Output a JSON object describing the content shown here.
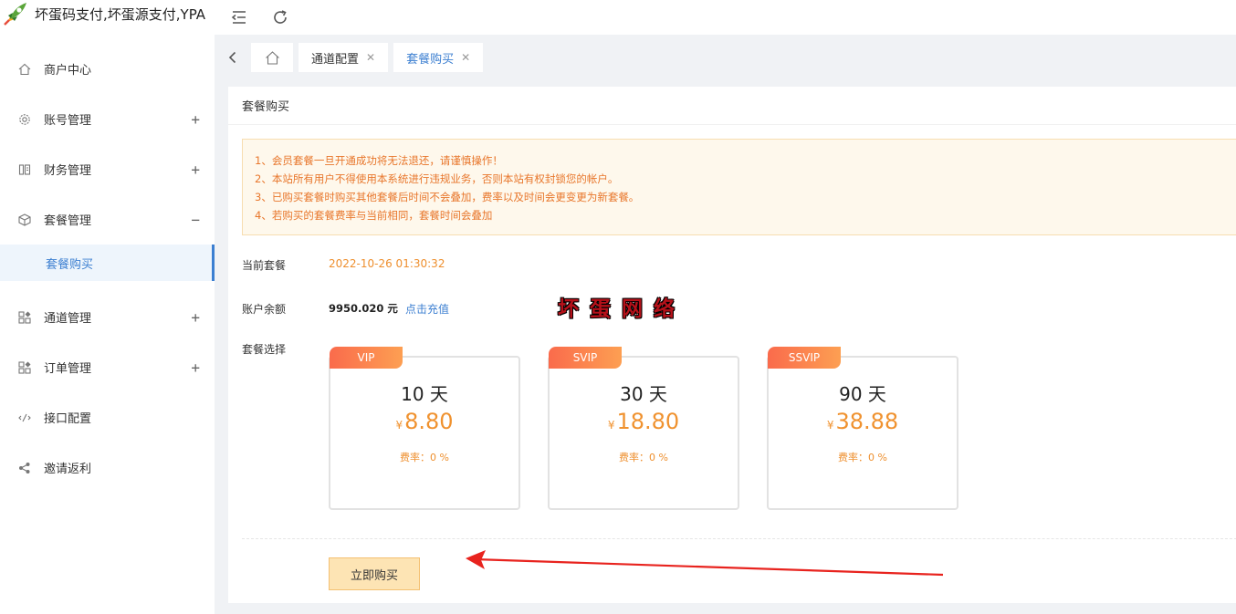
{
  "app": {
    "title": "坏蛋码支付,坏蛋源支付,YPA"
  },
  "sidebar": {
    "items": [
      {
        "label": "商户中心",
        "icon": "home-icon",
        "toggle": ""
      },
      {
        "label": "账号管理",
        "icon": "gear-icon",
        "toggle": "+"
      },
      {
        "label": "财务管理",
        "icon": "ledger-icon",
        "toggle": "+"
      },
      {
        "label": "套餐管理",
        "icon": "cube-icon",
        "toggle": "−"
      },
      {
        "label": "通道管理",
        "icon": "grid-icon",
        "toggle": "+"
      },
      {
        "label": "订单管理",
        "icon": "grid-icon",
        "toggle": "+"
      },
      {
        "label": "接口配置",
        "icon": "api-icon",
        "toggle": ""
      },
      {
        "label": "邀请返利",
        "icon": "share-icon",
        "toggle": ""
      }
    ],
    "submenu": {
      "active_label": "套餐购买"
    }
  },
  "tabs": {
    "items": [
      {
        "label": "通道配置"
      },
      {
        "label": "套餐购买"
      }
    ]
  },
  "panel": {
    "title": "套餐购买",
    "notice": [
      "1、会员套餐一旦开通成功将无法退还，请谨慎操作！",
      "2、本站所有用户不得使用本系统进行违规业务，否则本站有权封锁您的帐户。",
      "3、已购买套餐时购买其他套餐后时间不会叠加，费率以及时间会更变更为新套餐。",
      "4、若购买的套餐费率与当前相同，套餐时间会叠加"
    ],
    "current_plan_label": "当前套餐",
    "current_plan_value": "2022-10-26 01:30:32",
    "balance_label": "账户余额",
    "balance_value": "9950.020 元",
    "recharge_link": "点击充值",
    "watermark": "坏蛋网络",
    "plan_select_label": "套餐选择",
    "plans": [
      {
        "badge": "VIP",
        "days": "10 天",
        "currency": "¥",
        "price": "8.80",
        "rate": "费率：0 %"
      },
      {
        "badge": "SVIP",
        "days": "30 天",
        "currency": "¥",
        "price": "18.80",
        "rate": "费率：0 %"
      },
      {
        "badge": "SSVIP",
        "days": "90 天",
        "currency": "¥",
        "price": "38.88",
        "rate": "费率：0 %"
      }
    ],
    "buy_button": "立即购买"
  },
  "colors": {
    "accent_blue": "#3c7fd1",
    "orange": "#f0922f",
    "annotation_arrow": "#e8231e"
  }
}
